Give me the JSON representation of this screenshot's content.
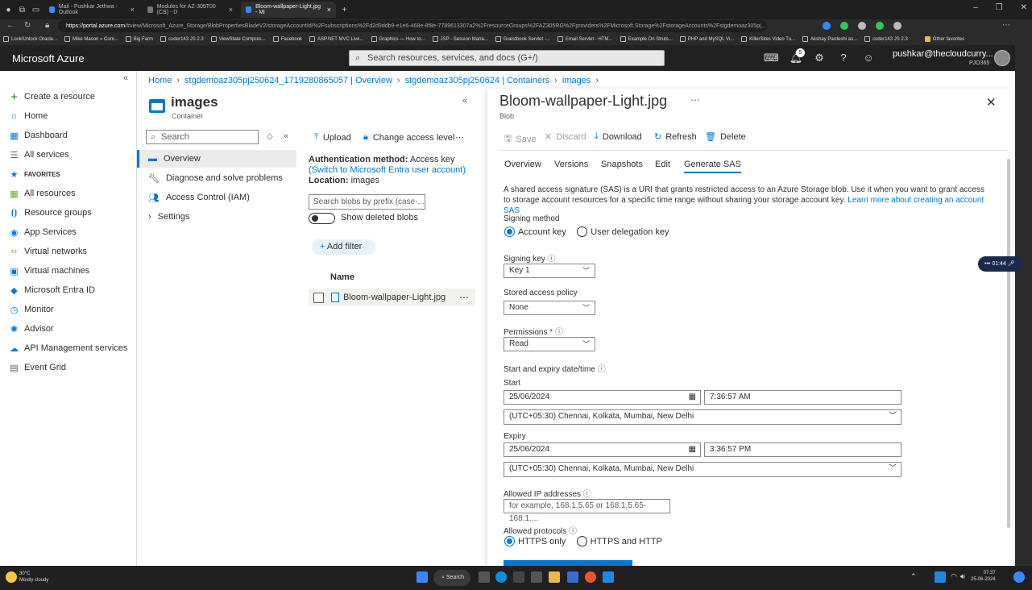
{
  "browser": {
    "tabs": [
      {
        "label": "Mail - Pushkar Jethwa - Outlook"
      },
      {
        "label": "Modules for AZ-305T00 (CS) - D"
      },
      {
        "label": "Bloom-wallpaper-Light.jpg - Mi"
      }
    ],
    "url_host": "https://portal.azure.com",
    "url_rest": "/#view/Microsoft_Azure_Storage/BlobPropertiesBladeV2/storageAccountId/%2Fsubscriptions%2Fd2d9ddb9-e1e6-468e-8f8e-7789613307a2%2FresourceGroups%2FAZ305RG%2Fproviders%2FMicrosoft.Storage%2FstorageAccounts%2Fstgdemoaz305pj...",
    "bookmarks": [
      "Lock/Unlock Oracle...",
      "Mike Mason » Com...",
      "Big Farm",
      "coder143 JS 2.3",
      "ViewState Compres...",
      "Facebook",
      "ASP.NET MVC Live...",
      "Graphics — How to...",
      "JSP - Session Mana...",
      "Guestbook Servlet -...",
      "Email Servlet - HTM...",
      "Example On Struts...",
      "PHP and MySQL Vi...",
      "KillerSites Video Tu...",
      "Akshay Pardeshi as...",
      "coder143 JS 2.3",
      "Other favorites"
    ]
  },
  "header": {
    "brand": "Microsoft Azure",
    "search_placeholder": "Search resources, services, and docs (G+/)",
    "notifications_count": "5",
    "user": "pushkar@thecloudcurry...",
    "tenant": "PJO365"
  },
  "leftnav": {
    "items": [
      {
        "label": "Create a resource"
      },
      {
        "label": "Home"
      },
      {
        "label": "Dashboard"
      },
      {
        "label": "All services"
      },
      {
        "label": "FAVORITES"
      },
      {
        "label": "All resources"
      },
      {
        "label": "Resource groups"
      },
      {
        "label": "App Services"
      },
      {
        "label": "Virtual networks"
      },
      {
        "label": "Virtual machines"
      },
      {
        "label": "Microsoft Entra ID"
      },
      {
        "label": "Monitor"
      },
      {
        "label": "Advisor"
      },
      {
        "label": "API Management services"
      },
      {
        "label": "Event Grid"
      }
    ]
  },
  "breadcrumb": [
    "Home",
    "stgdemoaz305pj250624_1719280865057 | Overview",
    "stgdemoaz305pj250624 | Containers",
    "images"
  ],
  "container": {
    "title": "images",
    "subtitle": "Container",
    "search_placeholder": "Search",
    "menu": [
      {
        "label": "Overview"
      },
      {
        "label": "Diagnose and solve problems"
      },
      {
        "label": "Access Control (IAM)"
      },
      {
        "label": "Settings"
      }
    ]
  },
  "blobs": {
    "toolbar": {
      "upload": "Upload",
      "change_access": "Change access level"
    },
    "auth_label": "Authentication method:",
    "auth_value": "Access key",
    "auth_link": "(Switch to Microsoft Entra user account)",
    "location_label": "Location:",
    "location_value": "images",
    "search_placeholder": "Search blobs by prefix (case-...",
    "show_deleted": "Show deleted blobs",
    "add_filter": "Add filter",
    "column_name": "Name",
    "rows": [
      {
        "name": "Bloom-wallpaper-Light.jpg"
      }
    ]
  },
  "blade": {
    "title": "Bloom-wallpaper-Light.jpg",
    "subtitle": "Blob",
    "toolbar": {
      "save": "Save",
      "discard": "Discard",
      "download": "Download",
      "refresh": "Refresh",
      "delete": "Delete"
    },
    "tabs": [
      "Overview",
      "Versions",
      "Snapshots",
      "Edit",
      "Generate SAS"
    ],
    "selected_tab": "Generate SAS",
    "description": "A shared access signature (SAS) is a URI that grants restricted access to an Azure Storage blob. Use it when you want to grant access to storage account resources for a specific time range without sharing your storage account key.",
    "description_link": "Learn more about creating an account SAS",
    "signing_method": {
      "label": "Signing method",
      "options": [
        "Account key",
        "User delegation key"
      ],
      "selected": "Account key"
    },
    "signing_key": {
      "label": "Signing key",
      "value": "Key 1"
    },
    "stored_policy": {
      "label": "Stored access policy",
      "value": "None"
    },
    "permissions": {
      "label": "Permissions",
      "required": "*",
      "value": "Read"
    },
    "expiry_section": "Start and expiry date/time",
    "start": {
      "label": "Start",
      "date": "25/06/2024",
      "time": "7:36:57 AM",
      "timezone": "(UTC+05:30) Chennai, Kolkata, Mumbai, New Delhi"
    },
    "expiry": {
      "label": "Expiry",
      "date": "25/06/2024",
      "time": "3:36:57 PM",
      "timezone": "(UTC+05:30) Chennai, Kolkata, Mumbai, New Delhi"
    },
    "allowed_ip": {
      "label": "Allowed IP addresses",
      "placeholder": "for example, 168.1.5.65 or 168.1.5.65-168.1...."
    },
    "protocols": {
      "label": "Allowed protocols",
      "options": [
        "HTTPS only",
        "HTTPS and HTTP"
      ],
      "selected": "HTTPS only"
    }
  },
  "recorder": {
    "time": "01:44"
  },
  "taskbar": {
    "weather_temp": "30°C",
    "weather_desc": "Mostly cloudy",
    "search": "Search",
    "time": "07:37",
    "date": "25-06-2024"
  },
  "colors": {
    "accent": "#0078d4",
    "header_bg": "#212121",
    "chrome_bg": "#1f1f1f"
  }
}
